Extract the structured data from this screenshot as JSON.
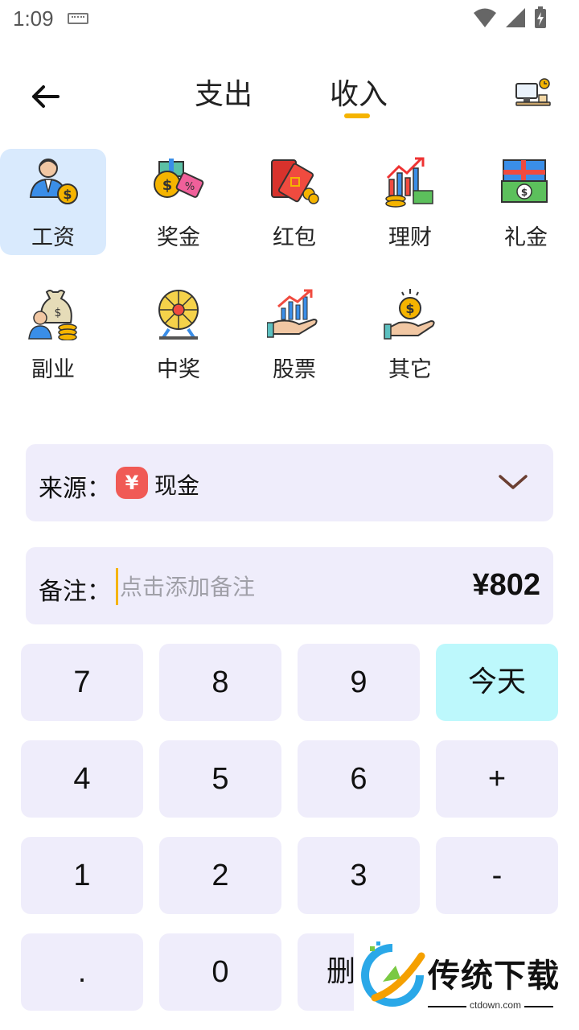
{
  "status_bar": {
    "time": "1:09"
  },
  "header": {
    "tabs": [
      {
        "label": "支出",
        "active": false
      },
      {
        "label": "收入",
        "active": true
      }
    ],
    "accent_color": "#f5b400"
  },
  "categories": [
    {
      "label": "工资",
      "icon": "salary-icon",
      "selected": true
    },
    {
      "label": "奖金",
      "icon": "bonus-icon",
      "selected": false
    },
    {
      "label": "红包",
      "icon": "red-envelope-icon",
      "selected": false
    },
    {
      "label": "理财",
      "icon": "investment-icon",
      "selected": false
    },
    {
      "label": "礼金",
      "icon": "gift-money-icon",
      "selected": false
    },
    {
      "label": "副业",
      "icon": "side-job-icon",
      "selected": false
    },
    {
      "label": "中奖",
      "icon": "lottery-wheel-icon",
      "selected": false
    },
    {
      "label": "股票",
      "icon": "stock-icon",
      "selected": false
    },
    {
      "label": "其它",
      "icon": "other-coin-icon",
      "selected": false
    }
  ],
  "source": {
    "label": "来源：",
    "badge": "¥",
    "value": "现金"
  },
  "note": {
    "label": "备注：",
    "placeholder": "点击添加备注",
    "amount": "¥802"
  },
  "keypad": {
    "keys": [
      "7",
      "8",
      "9",
      "今天",
      "4",
      "5",
      "6",
      "+",
      "1",
      "2",
      "3",
      "-",
      ".",
      "0",
      "删"
    ]
  },
  "watermark": {
    "title": "传统下载",
    "site": "ctdown.com"
  }
}
